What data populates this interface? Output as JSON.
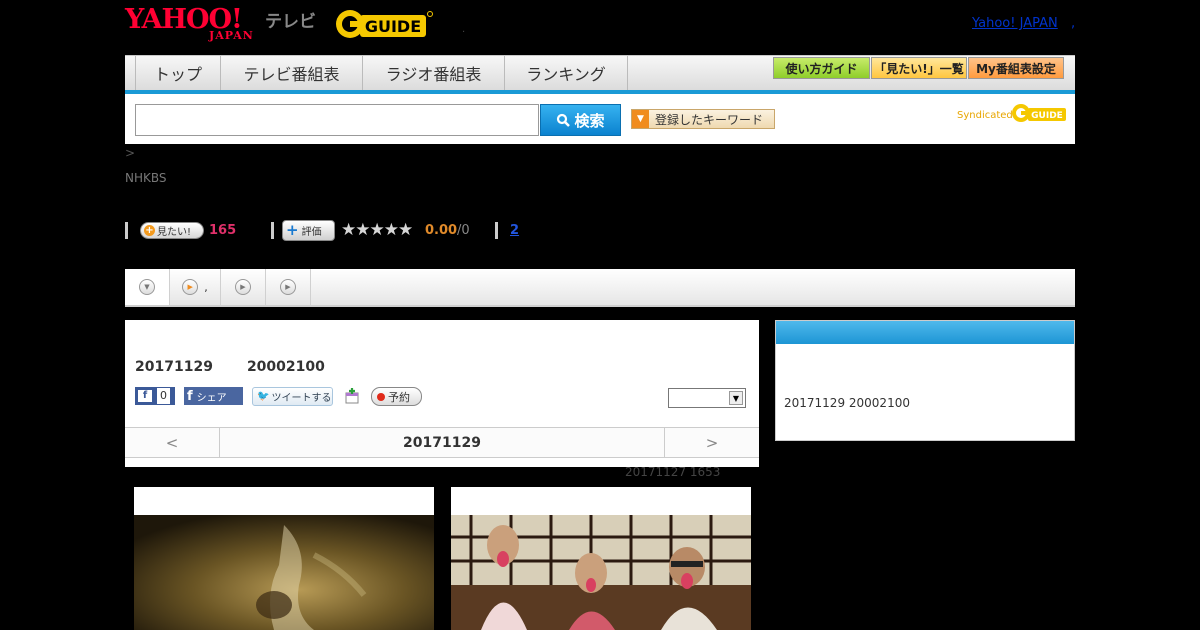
{
  "header": {
    "yahoo_logo_text": "YAHOO!",
    "yahoo_japan_text": "JAPAN",
    "tv_label": "テレビ",
    "gguide_text": "GUIDE",
    "dot": ".",
    "link_text": "Yahoo! JAPAN",
    "link_trailing": ","
  },
  "nav": {
    "tabs": [
      "トップ",
      "テレビ番組表",
      "ラジオ番組表",
      "ランキング"
    ],
    "guide_buttons": [
      "使い方ガイド",
      "「見たい!」一覧",
      "My番組表設定"
    ]
  },
  "search": {
    "value": "",
    "select_value": "",
    "button_label": "検索",
    "keyword_button_label": "登録したキーワード",
    "syndicated_label": "Syndicated"
  },
  "breadcrumb": ">",
  "channel": "NHKBS",
  "stats": {
    "mitai_label": "見たい!",
    "mitai_count": "165",
    "hyoka_label": "評価",
    "stars": "★★★★★",
    "rating": 0.0,
    "score": "0.00",
    "score_count": "/0",
    "link_count": "2"
  },
  "tabs_bar": {
    "tab2_text": ","
  },
  "program": {
    "date": "20171129",
    "time": "20002100",
    "fb_like_count": "0",
    "fb_share_label": "シェア",
    "tweet_label": "ツイートする",
    "yoyaku_label": "予約",
    "select_value": "",
    "daynav": {
      "prev": "<",
      "current": "20171129",
      "next": ">"
    },
    "updated": "20171127  1653"
  },
  "sidebar": {
    "header": "",
    "schedule_text": "20171129  20002100"
  },
  "colors": {
    "yahoo_red": "#ff0033",
    "nav_blue": "#1a9ad6",
    "mitai_pink": "#e0306a",
    "score_orange": "#e08a2a",
    "gguide_yellow": "#f5c800"
  }
}
